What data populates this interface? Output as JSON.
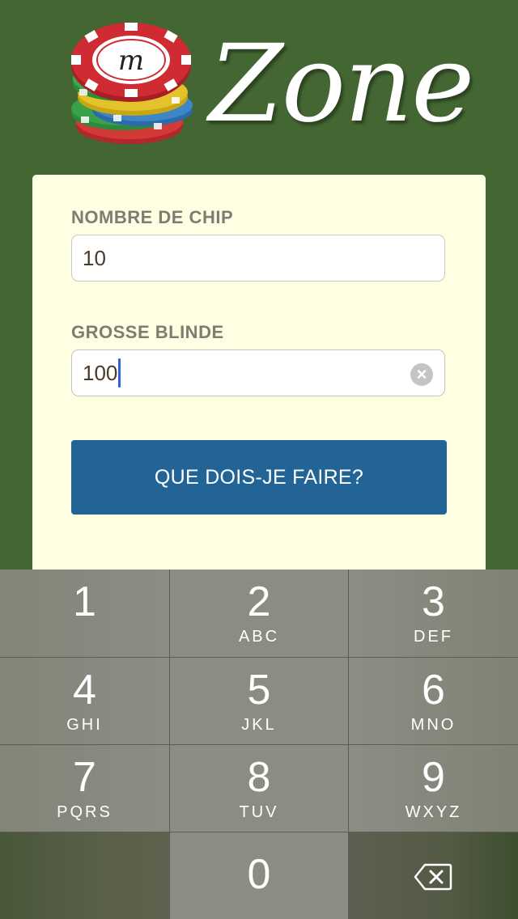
{
  "app": {
    "logo_text": "Zone",
    "logo_chip_letter": "m"
  },
  "form": {
    "chip_label": "NOMBRE DE CHIP",
    "chip_value": "10",
    "blind_label": "GROSSE BLINDE",
    "blind_value": "100",
    "submit_label": "QUE DOIS-JE FAIRE?"
  },
  "keypad": {
    "keys": [
      {
        "num": "1",
        "letters": ""
      },
      {
        "num": "2",
        "letters": "ABC"
      },
      {
        "num": "3",
        "letters": "DEF"
      },
      {
        "num": "4",
        "letters": "GHI"
      },
      {
        "num": "5",
        "letters": "JKL"
      },
      {
        "num": "6",
        "letters": "MNO"
      },
      {
        "num": "7",
        "letters": "PQRS"
      },
      {
        "num": "8",
        "letters": "TUV"
      },
      {
        "num": "9",
        "letters": "WXYZ"
      },
      {
        "num": "0",
        "letters": ""
      }
    ],
    "delete_icon": "backspace-icon"
  },
  "colors": {
    "background": "#436632",
    "card": "#fefee2",
    "button": "#236497",
    "chip_red": "#c8242c",
    "caret": "#2e63d9"
  }
}
